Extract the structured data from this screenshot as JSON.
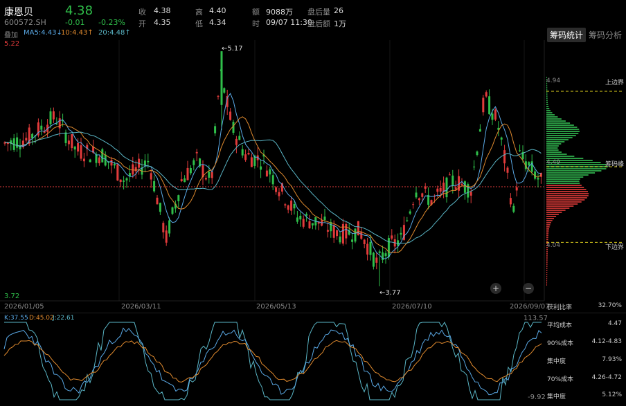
{
  "header": {
    "stock_name": "康恩贝",
    "stock_code": "600572.SH",
    "price": "4.38",
    "change": "-0.01",
    "change_pct": "-0.23%",
    "overlay_label": "叠加",
    "q": [
      {
        "label": "收",
        "value": "4.38"
      },
      {
        "label": "开",
        "value": "4.35"
      },
      {
        "label": "高",
        "value": "4.40"
      },
      {
        "label": "低",
        "value": "4.34"
      },
      {
        "label": "额",
        "value": "9088万"
      },
      {
        "label": "时",
        "value": "09/07 11:30"
      },
      {
        "label": "盘后量",
        "value": "26"
      },
      {
        "label": "盘后额",
        "value": "1万"
      }
    ]
  },
  "ma_legend": {
    "ma5": "MA5:4.43↓",
    "ma10": "10:4.43↑",
    "ma20": "20:4.48↑"
  },
  "tabs": {
    "active": "筹码统计",
    "other": "筹码分析"
  },
  "price_axis": {
    "top": "5.22",
    "bottom": "3.72"
  },
  "annotations": {
    "high": "←5.17",
    "low": "←3.77"
  },
  "dates": [
    "2026/01/05",
    "2026/03/11",
    "2026/05/13",
    "2026/07/10",
    "2026/09/07"
  ],
  "zoom": {
    "plus": "+",
    "minus": "−"
  },
  "chip": {
    "upper_price": "4.94",
    "upper_label": "上边界",
    "peak_price": "4.49",
    "peak_label": "筹码峰",
    "lower_price": "4.04",
    "lower_label": "下边界"
  },
  "stats": [
    {
      "label": "获利比率",
      "value": "32.70%"
    },
    {
      "label": "平均成本",
      "value": "4.47"
    },
    {
      "label": "90%成本",
      "value": "4.12-4.83"
    },
    {
      "label": "集中度",
      "value": "7.93%"
    },
    {
      "label": "70%成本",
      "value": "4.26-4.72"
    },
    {
      "label": "集中度",
      "value": "5.12%"
    }
  ],
  "kdj": {
    "k": "K:37.55",
    "d": "D:45.02",
    "j": "J:22.61",
    "top": "113.57",
    "bottom": "-9.92"
  },
  "colors": {
    "up": "#e23b3b",
    "down": "#2fbf4a",
    "ma5": "#5aa9e6",
    "ma10": "#e08a2e",
    "ma20": "#5ab6c6",
    "dashed": "#e0d21e"
  }
}
